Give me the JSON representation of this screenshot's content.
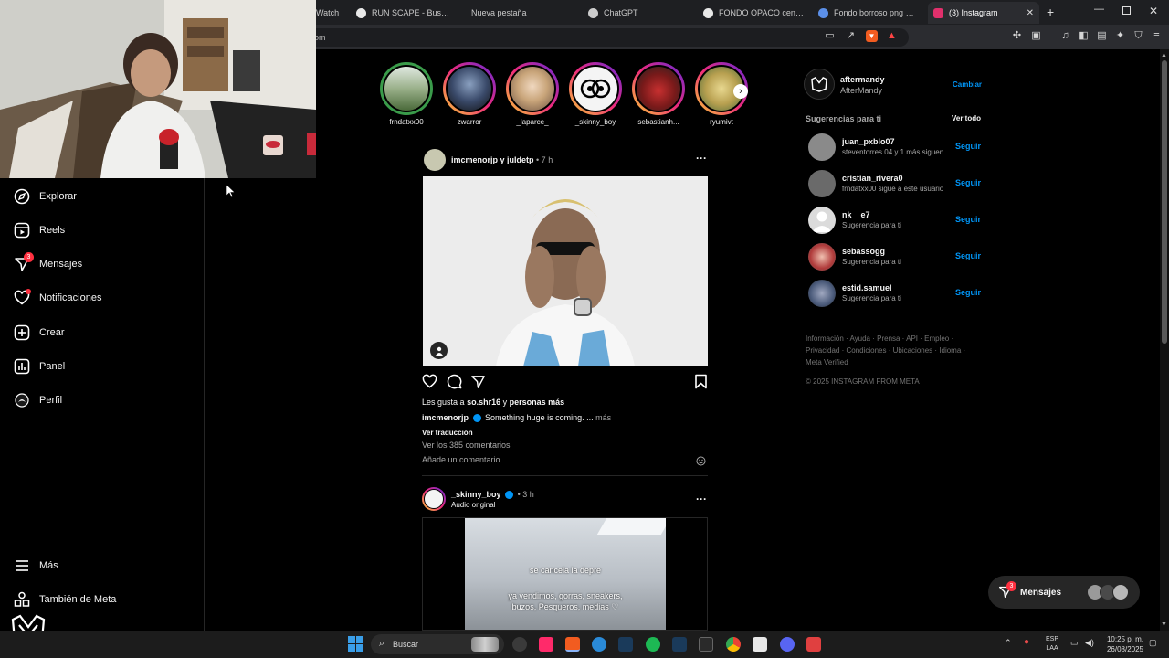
{
  "browser": {
    "tabs": [
      {
        "label": "Watch",
        "color": "#888888"
      },
      {
        "label": "RUN SCAPE - Buscar con G",
        "color": "#e8e8e8"
      },
      {
        "label": "Nueva pestaña",
        "color": "#555555"
      },
      {
        "label": "ChatGPT",
        "color": "#cccccc"
      },
      {
        "label": "FONDO OPACO censura p",
        "color": "#e8e8e8"
      },
      {
        "label": "Fondo borroso png imág",
        "color": "#5b8fe8"
      },
      {
        "label": "(3) Instagram",
        "color": "#e1306c"
      }
    ],
    "url_fragment": "om"
  },
  "sidebar": {
    "items": [
      {
        "label": "Explorar"
      },
      {
        "label": "Reels"
      },
      {
        "label": "Mensajes",
        "badge": "3"
      },
      {
        "label": "Notificaciones"
      },
      {
        "label": "Crear"
      },
      {
        "label": "Panel"
      },
      {
        "label": "Perfil"
      }
    ],
    "more": "Más",
    "meta": "También de Meta"
  },
  "stories": [
    {
      "name": "frndatxx00",
      "color": "#5a7a4a"
    },
    {
      "name": "zwarror",
      "color": "#3a4a6a"
    },
    {
      "name": "_laparce_",
      "color": "#c9a57a"
    },
    {
      "name": "_skinny_boy",
      "color": "#f4f4f4"
    },
    {
      "name": "sebastianh...",
      "color": "#9a2a2a"
    },
    {
      "name": "ryumivt",
      "color": "#b8a050"
    }
  ],
  "post1": {
    "header": "imcmenorjp y juldetp",
    "time": "• 7 h",
    "likes_prefix": "Les gusta a",
    "likes_user": "so.shr16",
    "likes_and": "y",
    "likes_rest": "personas más",
    "caption_user": "imcmenorjp",
    "caption": "Something huge is coming. ...",
    "more": "más",
    "translate": "Ver traducción",
    "comments": "Ver los 385 comentarios",
    "add_comment": "Añade un comentario..."
  },
  "post2": {
    "user": "_skinny_boy",
    "time": "• 3 h",
    "audio": "Audio original",
    "overlay1": "se cancela la depre",
    "overlay2": "ya vendimos, gorras, sneakers, buzos, Pesqueros, medias ♡"
  },
  "account": {
    "username": "aftermandy",
    "name": "AfterMandy",
    "switch": "Cambiar"
  },
  "suggestions": {
    "title": "Sugerencias para ti",
    "see_all": "Ver todo",
    "follow": "Seguir",
    "items": [
      {
        "user": "juan_pxblo07",
        "sub": "steventorres.04 y 1 más siguen ...",
        "color": "#8a8a8a"
      },
      {
        "user": "cristian_rivera0",
        "sub": "frndatxx00 sigue a este usuario",
        "color": "#6a6a6a"
      },
      {
        "user": "nk__e7",
        "sub": "Sugerencia para ti",
        "color": "#dbdbdb"
      },
      {
        "user": "sebassogg",
        "sub": "Sugerencia para ti",
        "color": "#b03a3a"
      },
      {
        "user": "estid.samuel",
        "sub": "Sugerencia para ti",
        "color": "#4a5a7a"
      }
    ]
  },
  "footer": {
    "line1": "Información · Ayuda · Prensa · API · Empleo ·",
    "line2": "Privacidad · Condiciones · Ubicaciones · Idioma ·",
    "line3": "Meta Verified",
    "copy": "© 2025 INSTAGRAM FROM META"
  },
  "messages_bubble": {
    "label": "Mensajes",
    "badge": "3"
  },
  "taskbar": {
    "search": "Buscar",
    "lang1": "ESP",
    "lang2": "LAA",
    "time": "10:25 p. m.",
    "date": "26/08/2025"
  },
  "colors": {
    "accent": "#0095f6",
    "badge": "#ff3040",
    "bg": "#000000"
  }
}
